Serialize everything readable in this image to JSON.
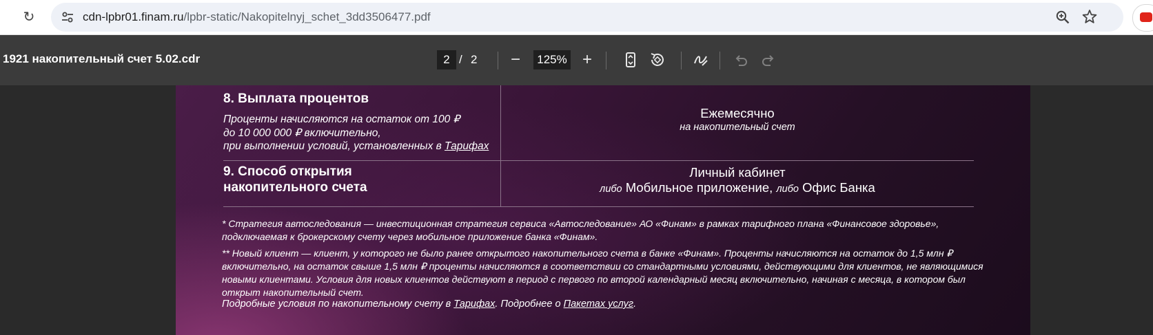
{
  "browser": {
    "url_host": "cdn-lpbr01.finam.ru",
    "url_path": "/lpbr-static/Nakopitelnyj_schet_3dd3506477.pdf"
  },
  "pdf_toolbar": {
    "title": "1921 накопительный счет 5.02.cdr",
    "current_page": "2",
    "page_separator": "/",
    "total_pages": "2",
    "zoom": "125%"
  },
  "document": {
    "section8": {
      "title": "8. Выплата процентов",
      "desc_line1": "Проценты начисляются на остаток от 100 ₽",
      "desc_line2": "до 10 000 000 ₽ включительно,",
      "desc_line3_prefix": "при выполнении условий, установленных в ",
      "desc_line3_link": "Тарифах",
      "value_main": "Ежемесячно",
      "value_sub": "на накопительный счет"
    },
    "section9": {
      "title_line1": "9. Способ открытия",
      "title_line2": "накопительного счета",
      "value_line1": "Личный кабинет",
      "conj1": "либо",
      "option2": "Мобильное приложение,",
      "conj2": "либо",
      "option3": "Офис Банка"
    },
    "footnotes": {
      "note1_line1": "* Стратегия автоследования — инвестиционная стратегия сервиса «Автоследование» АО «Финам» в рамках тарифного плана «Финансовое здоровье»,",
      "note1_line2": "подключаемая к брокерскому счету через мобильное приложение банка «Финам».",
      "note2_line1": "** Новый клиент — клиент, у которого не было ранее открытого накопительного счета в банке «Финам». Проценты начисляются на остаток до 1,5 млн ₽",
      "note2_line2": "включительно, на остаток свыше 1,5 млн ₽ проценты начисляются в соответствии со стандартными условиями, действующими для клиентов, не являющимися",
      "note2_line3": "новыми клиентами. Условия для новых клиентов действуют в период с первого по второй календарный месяц включительно, начиная с месяца, в котором был",
      "note2_line4": "открыт накопительный счет.",
      "note3_prefix": "Подробные условия по накопительному счету в ",
      "note3_link1": "Тарифах",
      "note3_middle": ". Подробнее о ",
      "note3_link2": "Пакетах услуг",
      "note3_suffix": "."
    }
  },
  "icons": {
    "reload": "reload-icon",
    "site_info": "tune-icon",
    "zoom": "zoom-in-icon",
    "bookmark": "star-icon",
    "extension": "youtube-icon"
  },
  "colors": {
    "toolbar_bg": "#3b3b3b",
    "viewer_bg": "#2a2a2a",
    "page_bg_dark": "#2a1129",
    "page_bg_accent": "#8c3773"
  }
}
